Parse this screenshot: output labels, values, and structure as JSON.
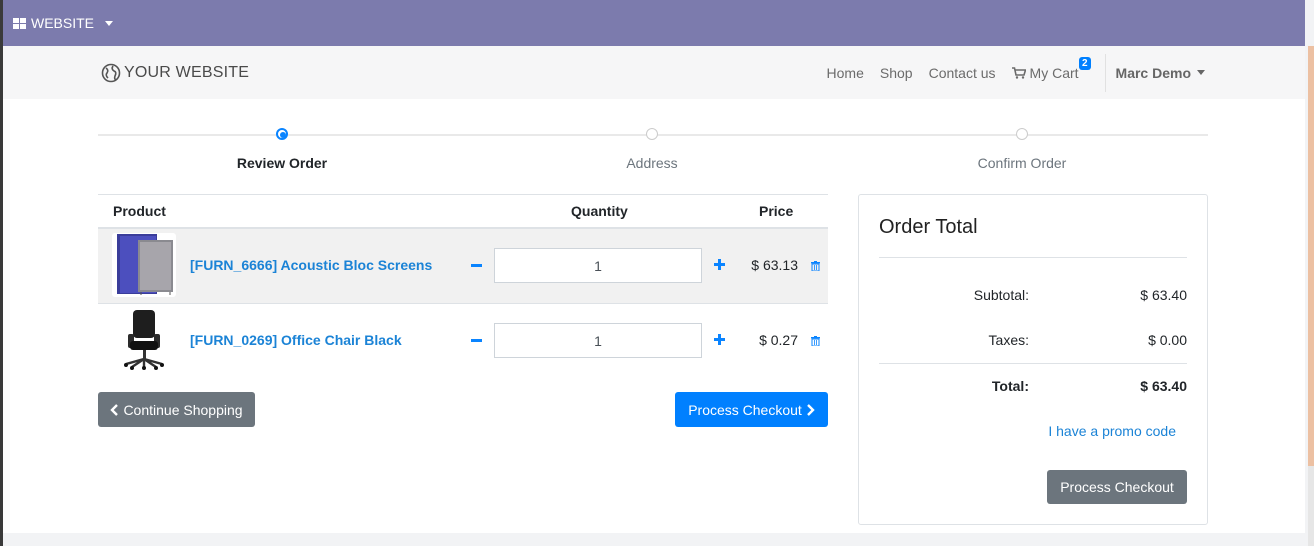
{
  "topbar": {
    "menu_label": "WEBSITE"
  },
  "navbar": {
    "brand": "YOUR WEBSITE",
    "links": [
      "Home",
      "Shop",
      "Contact us"
    ],
    "cart_label": "My Cart",
    "cart_count": "2",
    "user": "Marc Demo"
  },
  "steps": [
    {
      "label": "Review Order",
      "active": true
    },
    {
      "label": "Address",
      "active": false
    },
    {
      "label": "Confirm Order",
      "active": false
    }
  ],
  "table": {
    "headers": {
      "product": "Product",
      "quantity": "Quantity",
      "price": "Price"
    },
    "rows": [
      {
        "name": "[FURN_6666] Acoustic Bloc Screens",
        "quantity": "1",
        "price": "$ 63.13"
      },
      {
        "name": "[FURN_0269] Office Chair Black",
        "quantity": "1",
        "price": "$ 0.27"
      }
    ]
  },
  "buttons": {
    "continue": "Continue Shopping",
    "checkout": "Process Checkout"
  },
  "order_total": {
    "title": "Order Total",
    "subtotal_label": "Subtotal:",
    "subtotal": "$ 63.40",
    "taxes_label": "Taxes:",
    "taxes": "$ 0.00",
    "total_label": "Total:",
    "total": "$ 63.40",
    "promo": "I have a promo code",
    "checkout": "Process Checkout"
  },
  "colors": {
    "topbar": "#7c7bad",
    "primary": "#0080ff",
    "link": "#1b83d6",
    "secondary": "#6c757d"
  }
}
